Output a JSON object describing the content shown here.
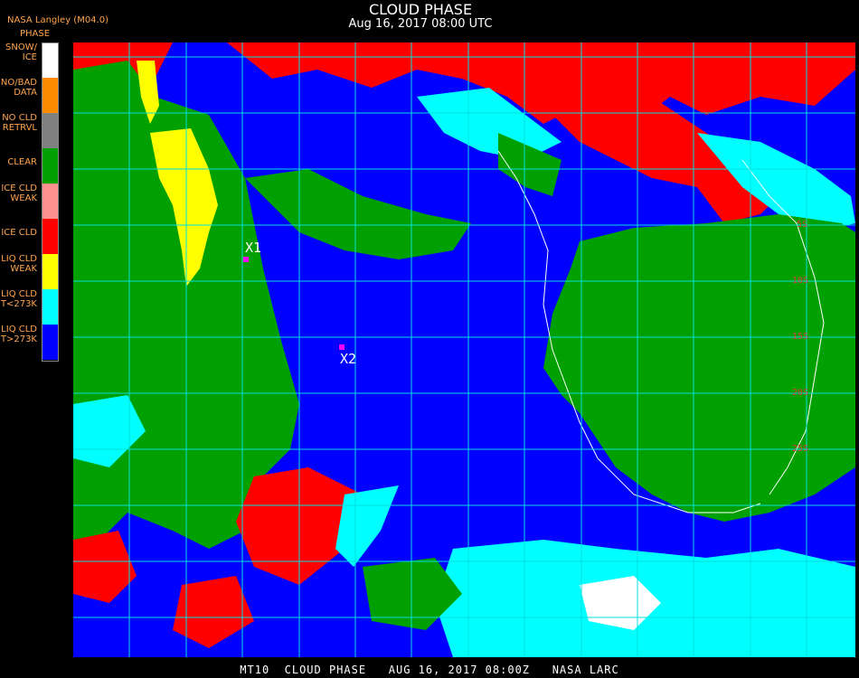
{
  "header": {
    "title": "CLOUD PHASE",
    "subtitle": "Aug 16, 2017 08:00 UTC"
  },
  "brand": "NASA Langley (M04.0)",
  "legend": {
    "heading": "PHASE",
    "items": [
      {
        "label": "SNOW/\nICE",
        "color": "#ffffff"
      },
      {
        "label": "NO/BAD\nDATA",
        "color": "#ff8c00"
      },
      {
        "label": "NO CLD\nRETRVL",
        "color": "#808080"
      },
      {
        "label": "CLEAR",
        "color": "#00a000"
      },
      {
        "label": "ICE CLD\nWEAK",
        "color": "#ff9090"
      },
      {
        "label": "ICE CLD",
        "color": "#ff0000"
      },
      {
        "label": "LIQ CLD\nWEAK",
        "color": "#ffff00"
      },
      {
        "label": "LIQ CLD\nT<273K",
        "color": "#00ffff"
      },
      {
        "label": "LIQ CLD\nT>273K",
        "color": "#0000ff"
      }
    ]
  },
  "markers": [
    {
      "label": "X1"
    },
    {
      "label": "X2"
    }
  ],
  "lat_labels": [
    "5S",
    "10S",
    "15S",
    "20S",
    "25S"
  ],
  "footer": "MT10  CLOUD PHASE   AUG 16, 2017 08:00Z   NASA LARC",
  "colors": {
    "ocean_liq_warm": "#0000ff",
    "clear": "#00a000",
    "ice": "#ff0000",
    "liq_cold": "#00ffff",
    "liq_weak": "#ffff00",
    "snow": "#ffffff",
    "grid": "#00e0e0",
    "marker_dot": "#ff00ff"
  }
}
